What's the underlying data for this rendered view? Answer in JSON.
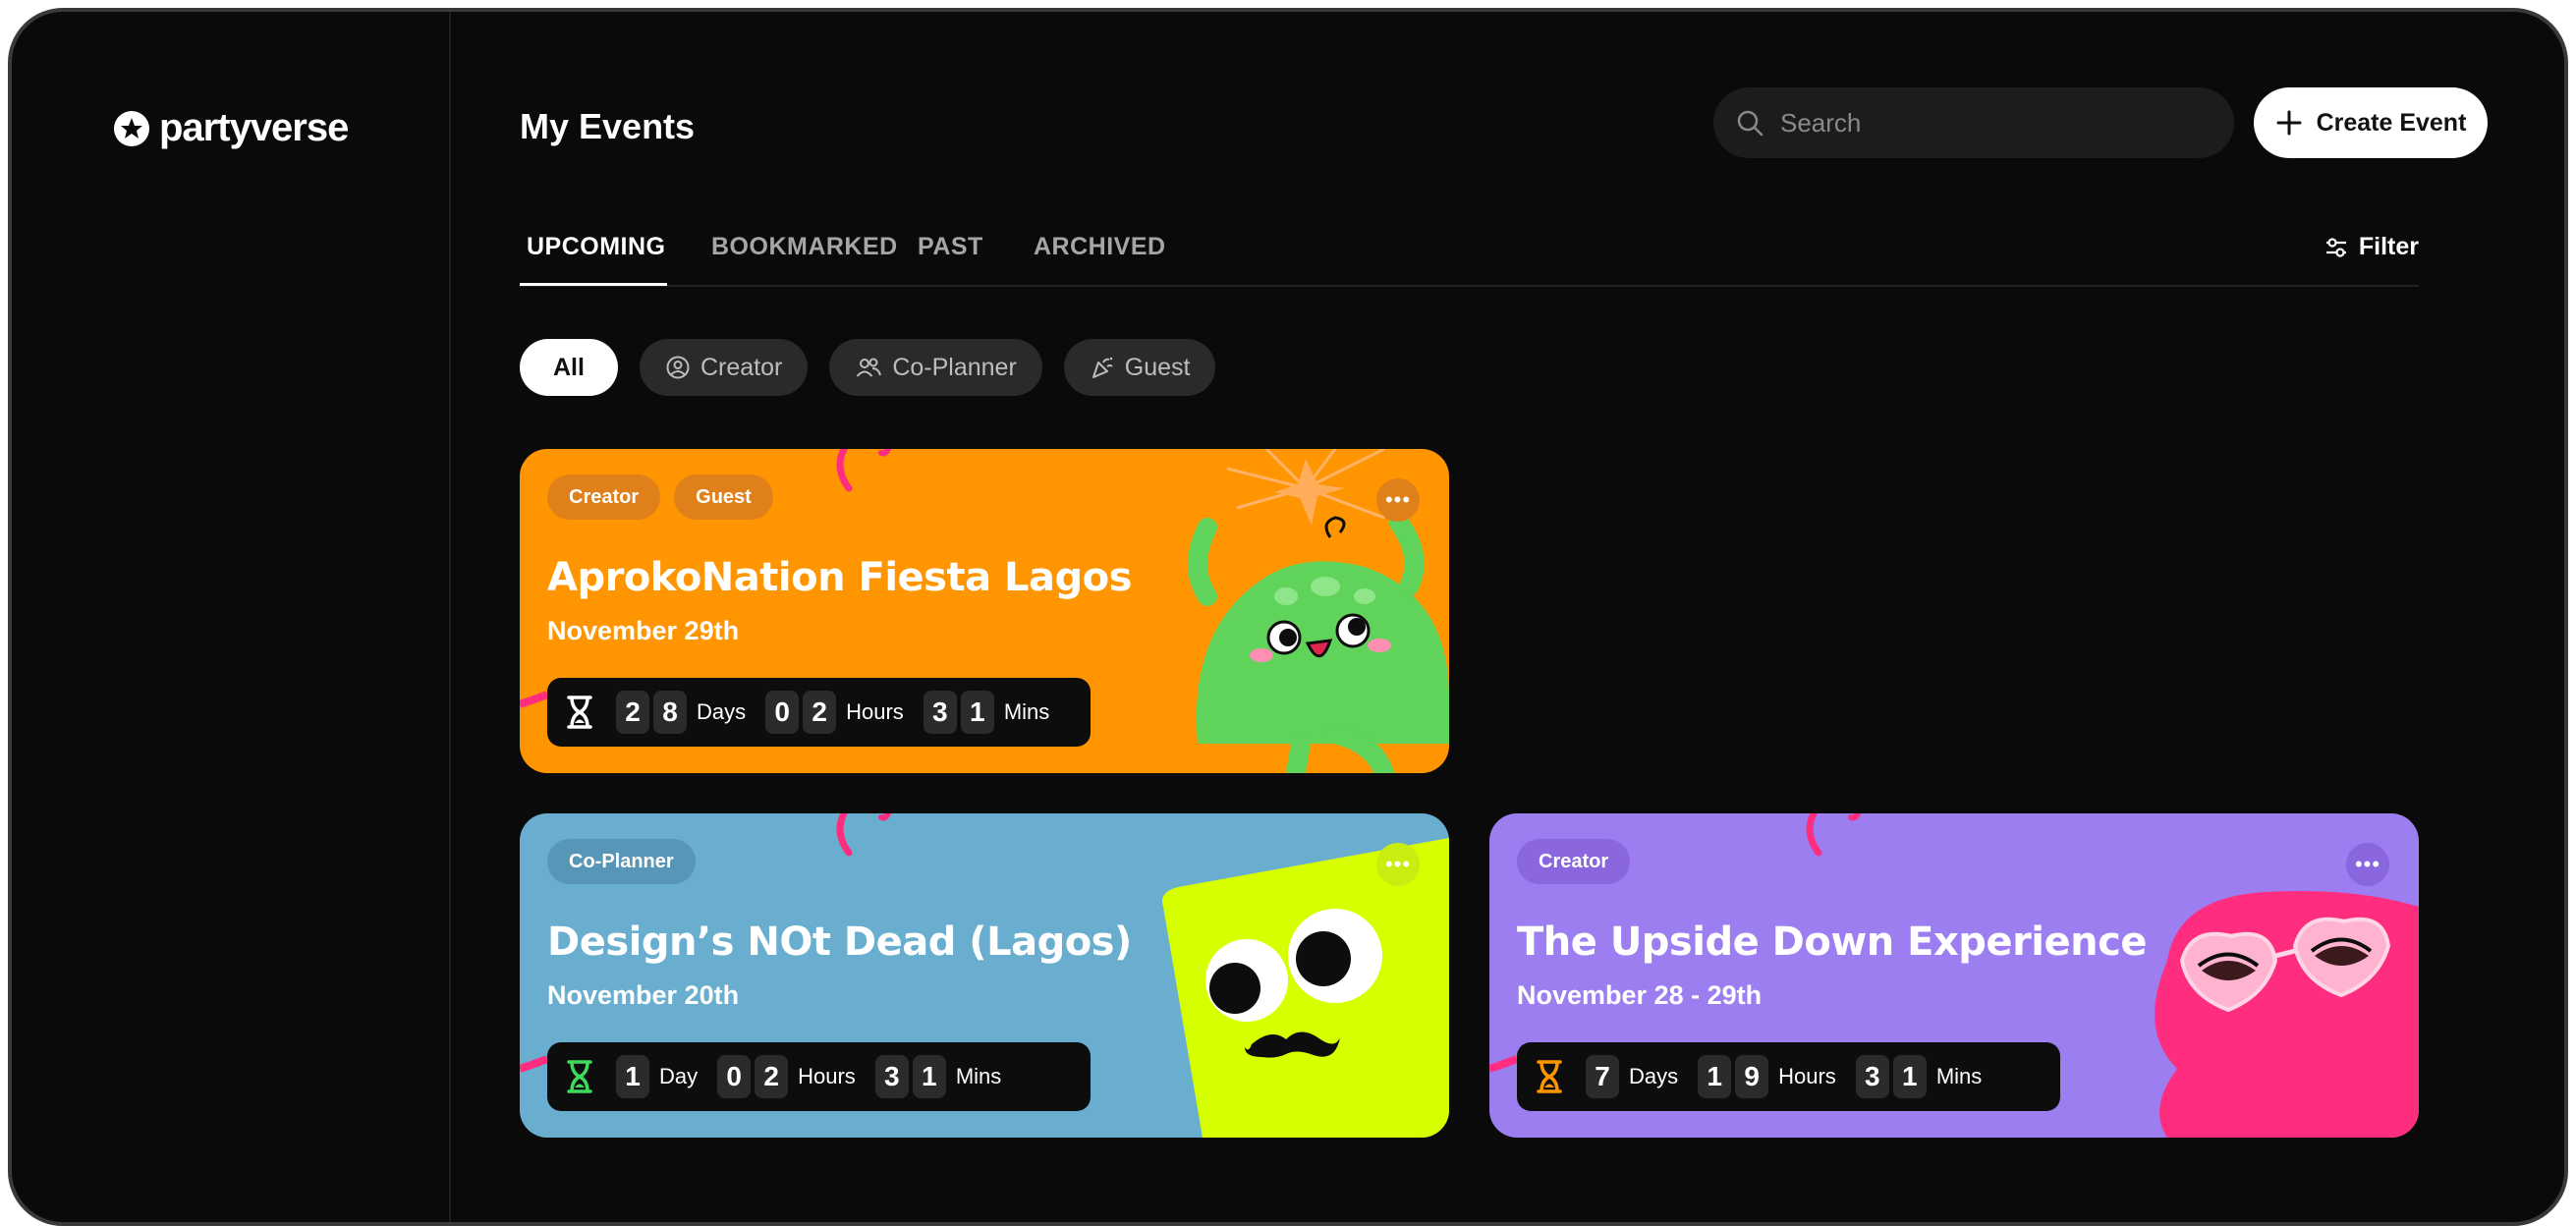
{
  "brand": {
    "name": "partyverse"
  },
  "header": {
    "title": "My Events",
    "search_placeholder": "Search",
    "create_label": "Create Event"
  },
  "tabs": [
    {
      "label": "UPCOMING",
      "active": true
    },
    {
      "label": "BOOKMARKED",
      "active": false
    },
    {
      "label": "PAST",
      "active": false
    },
    {
      "label": "ARCHIVED",
      "active": false
    }
  ],
  "filter_label": "Filter",
  "chips": [
    {
      "label": "All",
      "icon": "none",
      "active": true
    },
    {
      "label": "Creator",
      "icon": "user-circle-icon",
      "active": false
    },
    {
      "label": "Co-Planner",
      "icon": "users-icon",
      "active": false
    },
    {
      "label": "Guest",
      "icon": "party-popper-icon",
      "active": false
    }
  ],
  "events": [
    {
      "title": "AprokoNation Fiesta Lagos",
      "date": "November 29th",
      "tags": [
        "Creator",
        "Guest"
      ],
      "bg": "#ff9500",
      "tag_bg": "#e0801a",
      "hourglass_color": "#ffffff",
      "countdown": {
        "days": [
          "2",
          "8"
        ],
        "days_label": "Days",
        "hours": [
          "0",
          "2"
        ],
        "hours_label": "Hours",
        "mins": [
          "3",
          "1"
        ],
        "mins_label": "Mins"
      }
    },
    {
      "title": "Design’s NOt Dead (Lagos)",
      "date": "November 20th",
      "tags": [
        "Co-Planner"
      ],
      "bg": "#6aaecf",
      "tag_bg": "#5796b6",
      "hourglass_color": "#3ddc5a",
      "countdown": {
        "days": [
          "1"
        ],
        "days_label": "Day",
        "hours": [
          "0",
          "2"
        ],
        "hours_label": "Hours",
        "mins": [
          "3",
          "1"
        ],
        "mins_label": "Mins"
      }
    },
    {
      "title": "The Upside Down Experience",
      "date": "November 28 - 29th",
      "tags": [
        "Creator"
      ],
      "bg": "#9d7ef0",
      "tag_bg": "#8a67df",
      "hourglass_color": "#ff9500",
      "countdown": {
        "days": [
          "7"
        ],
        "days_label": "Days",
        "hours": [
          "1",
          "9"
        ],
        "hours_label": "Hours",
        "mins": [
          "3",
          "1"
        ],
        "mins_label": "Mins"
      }
    }
  ]
}
